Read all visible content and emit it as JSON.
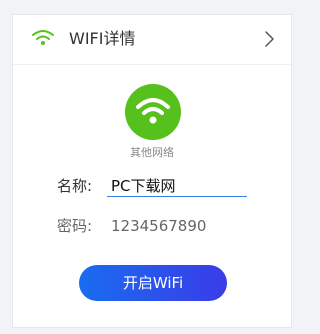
{
  "header": {
    "title": "WIFI详情",
    "icon": "wifi-icon",
    "chevron_icon": "chevron-right-icon"
  },
  "network": {
    "icon": "wifi-icon",
    "label": "其他网络"
  },
  "form": {
    "name_label": "名称:",
    "name_value": "PC下载网",
    "password_label": "密码:",
    "password_value": "1234567890"
  },
  "actions": {
    "open_wifi_label": "开启WiFi"
  },
  "colors": {
    "accent_green": "#56c11c",
    "button_gradient_start": "#1a6cf0",
    "button_gradient_end": "#3a3ce8",
    "input_underline": "#3b7fe0"
  }
}
